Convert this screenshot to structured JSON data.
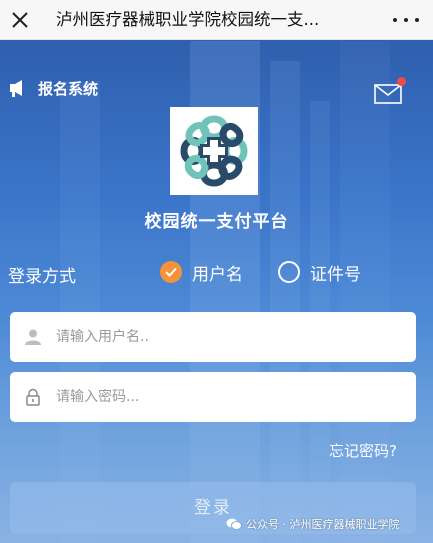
{
  "topbar": {
    "title": "泸州医疗器械职业学院校园统一支...",
    "close_icon": "close-icon",
    "more_icon": "more-dots-icon"
  },
  "header": {
    "system_label": "报名系统",
    "left_icon": "megaphone-icon",
    "mail_icon": "mail-icon"
  },
  "brand": {
    "platform_title": "校园统一支付平台",
    "logo_colors": {
      "teal": "#6fc3b8",
      "navy": "#2a4a6a"
    }
  },
  "login": {
    "method_label": "登录方式",
    "options": [
      {
        "label": "用户名",
        "selected": true
      },
      {
        "label": "证件号",
        "selected": false
      }
    ],
    "username_placeholder": "请输入用户名..",
    "password_placeholder": "请输入密码...",
    "forgot_label": "忘记密码?",
    "submit_label": "登录"
  },
  "watermark": {
    "text": "公众号 · 泸州医疗器械职业学院"
  },
  "colors": {
    "accent_orange": "#f5923a",
    "background_blue": "#3a74c9",
    "notification_red": "#f24848"
  }
}
